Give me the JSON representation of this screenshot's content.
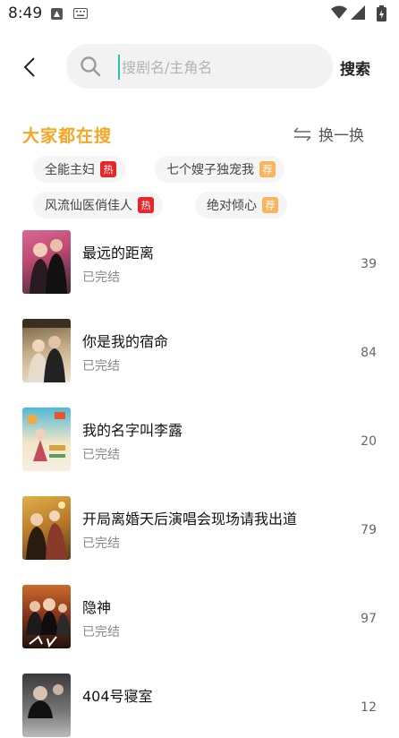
{
  "status_bar": {
    "time": "8:49"
  },
  "header": {
    "search_placeholder": "搜剧名/主角名",
    "search_button": "搜索"
  },
  "trending": {
    "title": "大家都在搜",
    "refresh_label": "换一换",
    "tags": [
      {
        "label": "全能主妇",
        "badge": "热",
        "badge_color": "#e8262a"
      },
      {
        "label": "七个嫂子独宠我",
        "badge": "荐",
        "badge_color": "#f7b65c"
      },
      {
        "label": "风流仙医俏佳人",
        "badge": "热",
        "badge_color": "#e8262a"
      },
      {
        "label": "绝对倾心",
        "badge": "荐",
        "badge_color": "#f7b65c"
      }
    ]
  },
  "dramas": [
    {
      "title": "最远的距离",
      "status": "已完结",
      "count": "39"
    },
    {
      "title": "你是我的宿命",
      "status": "已完结",
      "count": "84"
    },
    {
      "title": "我的名字叫李露",
      "status": "已完结",
      "count": "20"
    },
    {
      "title": "开局离婚天后演唱会现场请我出道",
      "status": "已完结",
      "count": "79"
    },
    {
      "title": "隐神",
      "status": "已完结",
      "count": "97"
    },
    {
      "title": "404号寝室",
      "status": "",
      "count": "12"
    }
  ],
  "colors": {
    "accent": "#f5a623",
    "cursor": "#2bbfb0",
    "hot": "#e8262a",
    "recommend": "#f7b65c"
  }
}
